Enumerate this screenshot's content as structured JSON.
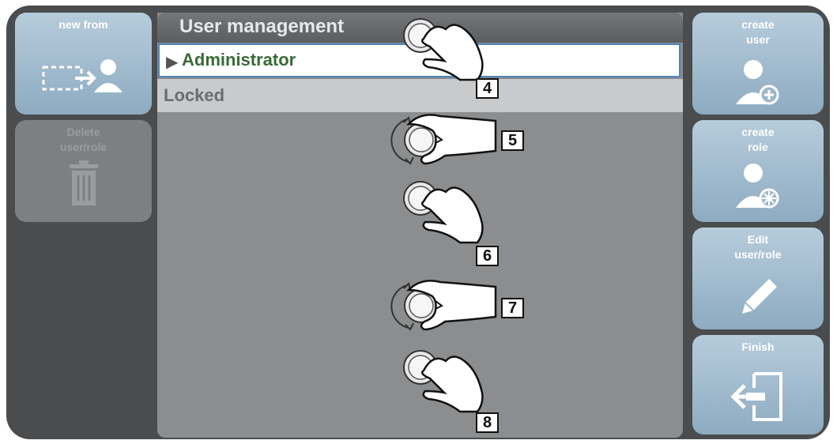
{
  "left_buttons": [
    {
      "label": "new from",
      "icon": "copy-user-icon",
      "enabled": true
    },
    {
      "label": "Delete\nuser/role",
      "icon": "trash-icon",
      "enabled": false
    }
  ],
  "right_buttons": [
    {
      "label": "create\nuser",
      "icon": "add-user-icon"
    },
    {
      "label": "create\nrole",
      "icon": "add-role-icon"
    },
    {
      "label": "Edit\nuser/role",
      "icon": "pencil-icon"
    },
    {
      "label": "Finish",
      "icon": "exit-icon"
    }
  ],
  "list": {
    "title": "User management",
    "rows": [
      {
        "label": "Administrator",
        "selected": true
      },
      {
        "label": "Locked",
        "selected": false
      }
    ]
  },
  "steps": [
    {
      "number": "4",
      "action": "press"
    },
    {
      "number": "5",
      "action": "turn"
    },
    {
      "number": "6",
      "action": "press"
    },
    {
      "number": "7",
      "action": "turn"
    },
    {
      "number": "8",
      "action": "press"
    }
  ],
  "colors": {
    "device_bg": "#4a4c4e",
    "button_blue": "#a3bdd0",
    "button_disabled": "#7d7f81",
    "list_bg": "#8b8d8f",
    "selected_text": "#376b35",
    "selected_border": "#4e86b6"
  }
}
